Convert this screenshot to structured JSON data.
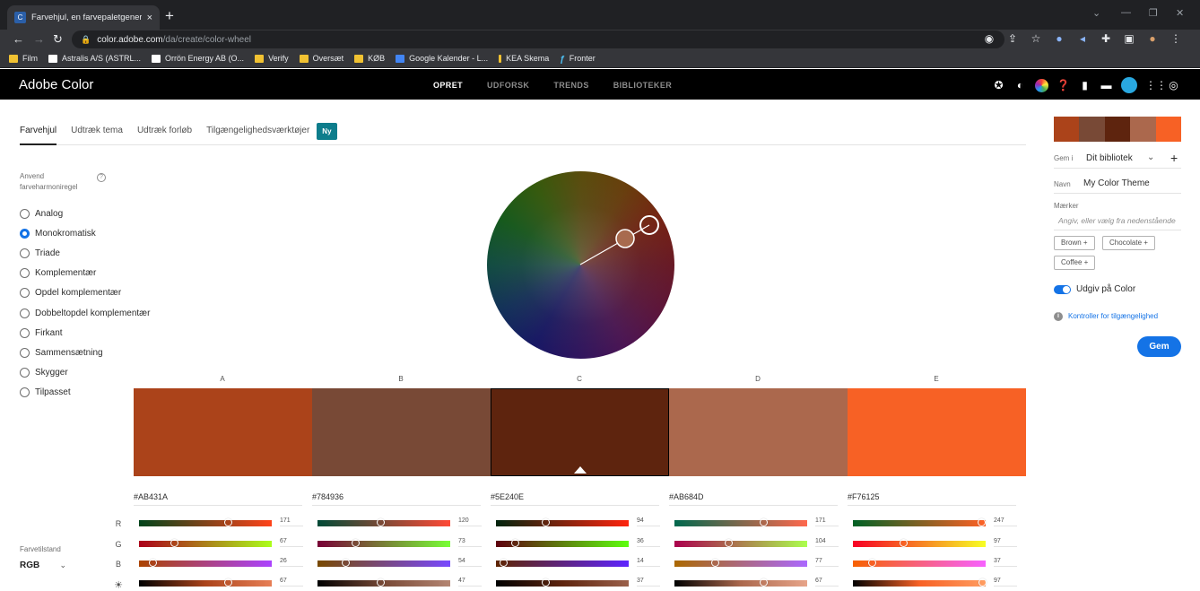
{
  "browser": {
    "tab_title": "Farvehjul, en farvepaletgenerator",
    "tab_close": "×",
    "new_tab": "+",
    "url_host": "color.adobe.com",
    "url_path": "/da/create/color-wheel",
    "bookmarks": [
      "Film",
      "Astralis A/S (ASTRL...",
      "Orrön Energy AB (O...",
      "Verify",
      "Oversæt",
      "KØB",
      "Google Kalender - L...",
      "KEA Skema",
      "Fronter"
    ]
  },
  "app": {
    "title": "Adobe Color",
    "nav": [
      "OPRET",
      "UDFORSK",
      "TRENDS",
      "BIBLIOTEKER"
    ]
  },
  "subtabs": {
    "items": [
      "Farvehjul",
      "Udtræk tema",
      "Udtræk forløb",
      "Tilgængelighedsværktøjer"
    ],
    "new_badge": "Ny"
  },
  "harmony": {
    "label": "Anvend farveharmoniregel",
    "help": "?",
    "options": [
      "Analog",
      "Monokromatisk",
      "Triade",
      "Komplementær",
      "Opdel komplementær",
      "Dobbeltopdel komplementær",
      "Firkant",
      "Sammensætning",
      "Skygger",
      "Tilpasset"
    ],
    "selected": "Monokromatisk"
  },
  "color_mode": {
    "label": "Farvetilstand",
    "value": "RGB"
  },
  "swatches": [
    {
      "letter": "A",
      "hex": "#AB431A",
      "r": 171,
      "g": 67,
      "b": 26,
      "bright": 67
    },
    {
      "letter": "B",
      "hex": "#784936",
      "r": 120,
      "g": 73,
      "b": 54,
      "bright": 47
    },
    {
      "letter": "C",
      "hex": "#5E240E",
      "r": 94,
      "g": 36,
      "b": 14,
      "bright": 37
    },
    {
      "letter": "D",
      "hex": "#AB684D",
      "r": 171,
      "g": 104,
      "b": 77,
      "bright": 67
    },
    {
      "letter": "E",
      "hex": "#F76125",
      "r": 247,
      "g": 97,
      "b": 37,
      "bright": 97
    }
  ],
  "selected_swatch": "C",
  "channels": [
    "R",
    "G",
    "B",
    "☀"
  ],
  "right_panel": {
    "save_in_label": "Gem i",
    "library": "Dit bibliotek",
    "name_label": "Navn",
    "name_value": "My Color Theme",
    "tags_label": "Mærker",
    "tags_placeholder": "Angiv, eller vælg fra nedenstående",
    "tags": [
      "Brown +",
      "Chocolate +",
      "Coffee +"
    ],
    "publish_label": "Udgiv på Color",
    "publish_on": true,
    "accessibility_link": "Kontroller for tilgængelighed",
    "save_button": "Gem"
  },
  "colors": {
    "accent": "#1473E6",
    "teal_badge": "#0D7D8C"
  }
}
